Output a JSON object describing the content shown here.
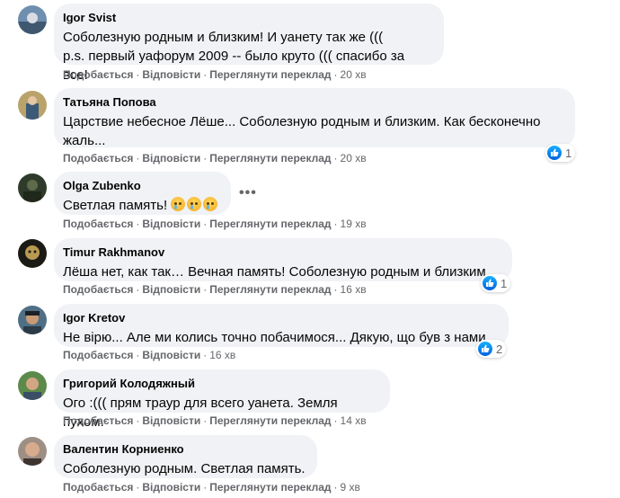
{
  "labels": {
    "like": "Подобається",
    "reply": "Відповісти",
    "translate": "Переглянути переклад",
    "dot": "·"
  },
  "colors": {
    "bubble": "#f0f2f5",
    "meta": "#65676b",
    "like_blue": "#1877f2"
  },
  "comments": [
    {
      "author": "Igor Svist",
      "lines": [
        "Соболезную родным и близким! И уанету так же (((",
        "p.s. первый уафорум 2009 -- было круто ((( спасибо за все!"
      ],
      "time": "20 хв",
      "has_translate": true
    },
    {
      "author": "Татьяна Попова",
      "lines": [
        "Царствие небесное Лёше... Соболезную родным и близким. Как бесконечно",
        "жаль..."
      ],
      "time": "20 хв",
      "has_translate": true,
      "reactions": "1"
    },
    {
      "author": "Olga Zubenko",
      "lines": [
        "Светлая память!"
      ],
      "emojis": [
        "crying-face",
        "crying-face",
        "crying-face"
      ],
      "time": "19 хв",
      "has_translate": true
    },
    {
      "author": "Timur Rakhmanov",
      "lines": [
        "Лёша нет, как так… Вечная память! Соболезную родным и близким…"
      ],
      "time": "16 хв",
      "has_translate": true,
      "reactions": "1"
    },
    {
      "author": "Igor Kretov",
      "lines": [
        "Не вірю... Але ми колись точно побачимося... Дякую, що був з нами..."
      ],
      "time": "16 хв",
      "has_translate": false,
      "reactions": "2"
    },
    {
      "author": "Григорий Колодяжный",
      "lines": [
        "Ого :((( прям траур для всего уанета. Земля пухом."
      ],
      "time": "14 хв",
      "has_translate": true
    },
    {
      "author": "Валентин Корниенко",
      "lines": [
        "Соболезную родным. Светлая память."
      ],
      "time": "9 хв",
      "has_translate": true
    }
  ]
}
